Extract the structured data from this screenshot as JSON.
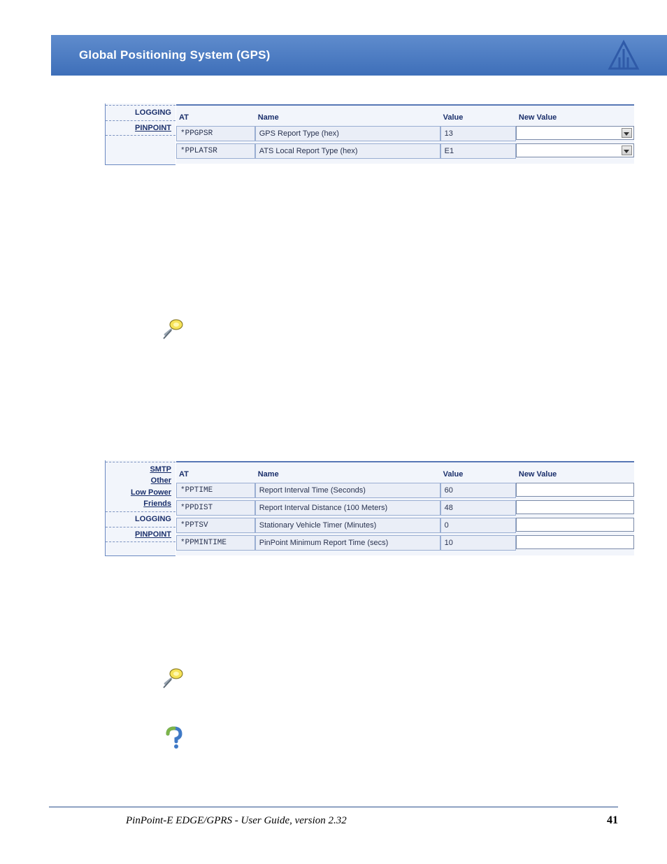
{
  "header": {
    "title": "Global Positioning System (GPS)"
  },
  "figure1": {
    "sidebar": [
      "LOGGING",
      "PINPOINT"
    ],
    "sidebar_link_flags": [
      false,
      true
    ],
    "headers": {
      "at": "AT",
      "name": "Name",
      "value": "Value",
      "newvalue": "New Value"
    },
    "rows": [
      {
        "at": "*PPGPSR",
        "name": "GPS Report Type (hex)",
        "value": "13",
        "dropdown": true
      },
      {
        "at": "*PPLATSR",
        "name": "ATS Local Report Type (hex)",
        "value": "E1",
        "dropdown": true
      }
    ]
  },
  "figure2": {
    "sidebar": [
      "SMTP",
      "Other",
      "Low Power",
      "Friends",
      "LOGGING",
      "PINPOINT"
    ],
    "sidebar_link_flags": [
      true,
      true,
      true,
      true,
      false,
      true
    ],
    "sidebar_rules_after": [
      false,
      false,
      false,
      true,
      true,
      true
    ],
    "headers": {
      "at": "AT",
      "name": "Name",
      "value": "Value",
      "newvalue": "New Value"
    },
    "rows": [
      {
        "at": "*PPTIME",
        "name": "Report Interval Time (Seconds)",
        "value": "60",
        "dropdown": false
      },
      {
        "at": "*PPDIST",
        "name": "Report Interval Distance (100 Meters)",
        "value": "48",
        "dropdown": false
      },
      {
        "at": "*PPTSV",
        "name": "Stationary Vehicle Timer (Minutes)",
        "value": "0",
        "dropdown": false
      },
      {
        "at": "*PPMINTIME",
        "name": "PinPoint Minimum Report Time (secs)",
        "value": "10",
        "dropdown": false
      }
    ]
  },
  "footer": {
    "doc_title": "PinPoint-E EDGE/GPRS - User Guide, version 2.32",
    "page_number": "41"
  }
}
